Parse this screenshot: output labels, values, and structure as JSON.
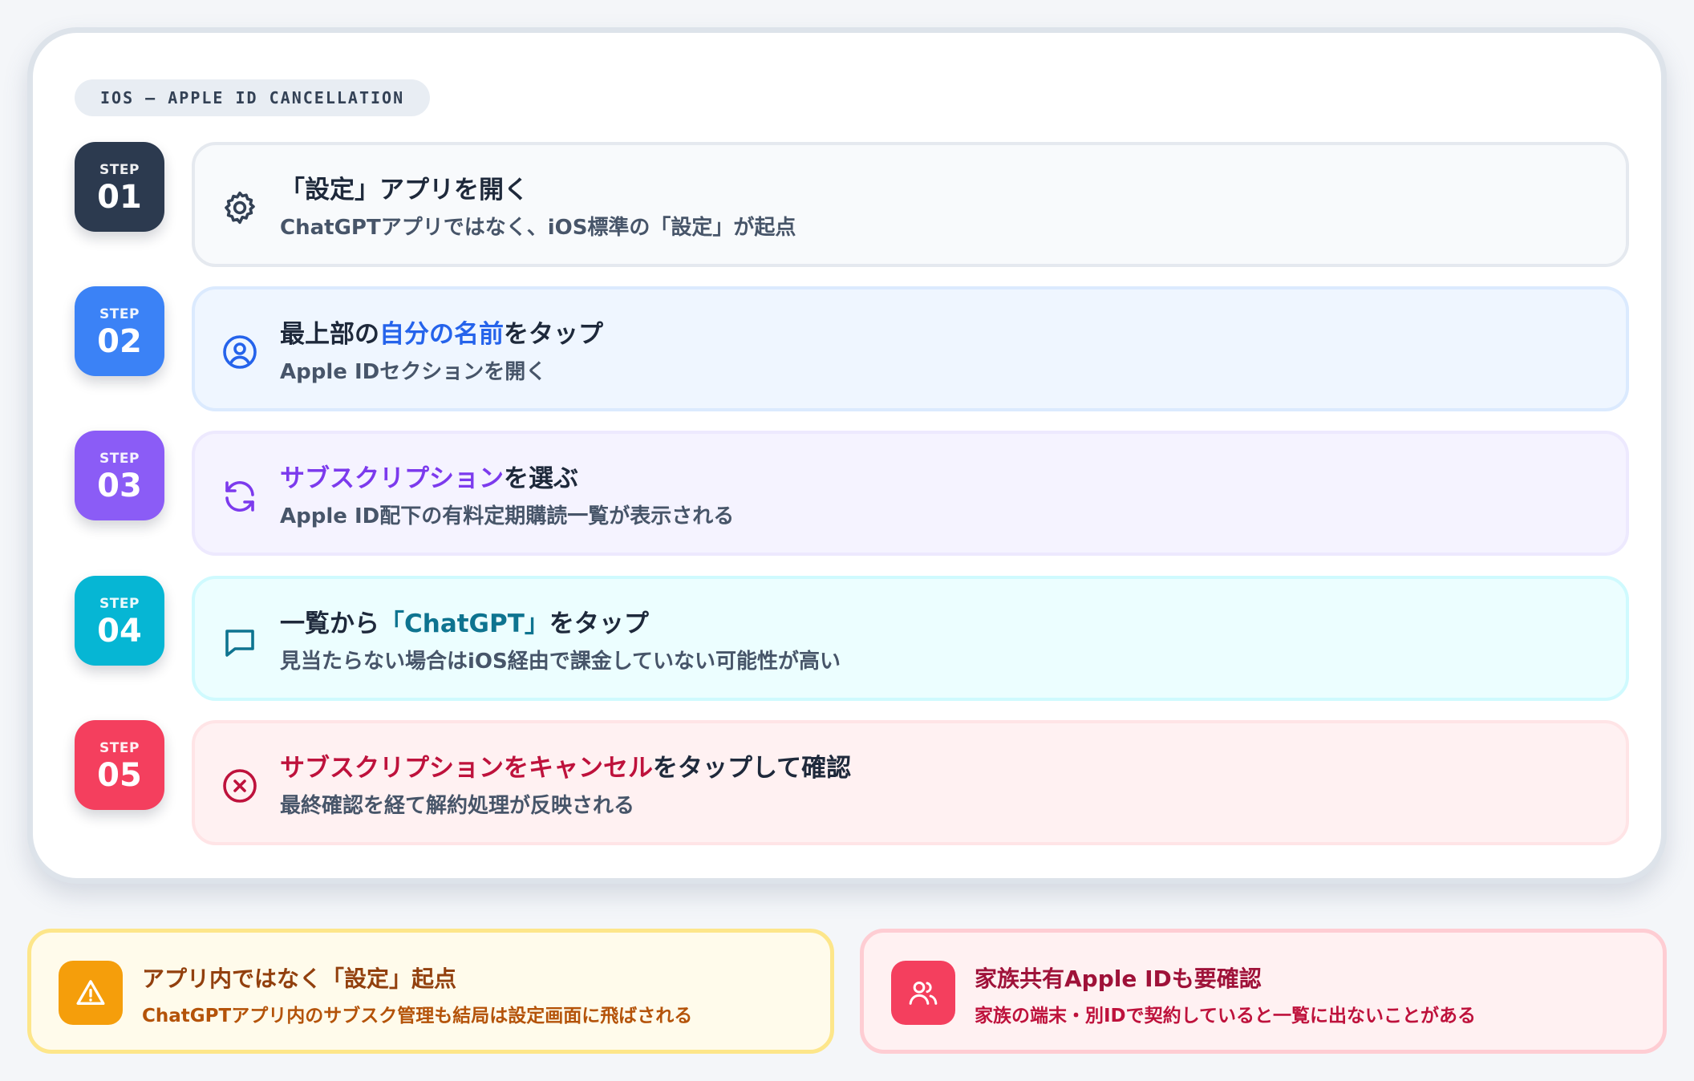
{
  "colors": {
    "step1": "#2c3a4f",
    "step2": "#3b82f6",
    "step3": "#8b5cf6",
    "step4": "#06b6d4",
    "step5": "#f43f5e"
  },
  "header": {
    "label": "IOS – APPLE ID CANCELLATION"
  },
  "steps": [
    {
      "badge_word": "STEP",
      "badge_num": "01",
      "icon": "gear-icon",
      "title_pre": "「設定」アプリを開く",
      "title_hl": "",
      "title_post": "",
      "subtitle": "ChatGPTアプリではなく、iOS標準の「設定」が起点"
    },
    {
      "badge_word": "STEP",
      "badge_num": "02",
      "icon": "user-circle-icon",
      "title_pre": "最上部の",
      "title_hl": "自分の名前",
      "title_post": "をタップ",
      "subtitle": "Apple IDセクションを開く"
    },
    {
      "badge_word": "STEP",
      "badge_num": "03",
      "icon": "refresh-icon",
      "title_pre": "",
      "title_hl": "サブスクリプション",
      "title_post": "を選ぶ",
      "subtitle": "Apple ID配下の有料定期購読一覧が表示される"
    },
    {
      "badge_word": "STEP",
      "badge_num": "04",
      "icon": "message-icon",
      "title_pre": "一覧から",
      "title_hl": "「ChatGPT」",
      "title_post": "をタップ",
      "subtitle": "見当たらない場合はiOS経由で課金していない可能性が高い"
    },
    {
      "badge_word": "STEP",
      "badge_num": "05",
      "icon": "cancel-circle-icon",
      "title_pre": "",
      "title_hl": "サブスクリプションをキャンセル",
      "title_post": "をタップして確認",
      "subtitle": "最終確認を経て解約処理が反映される"
    }
  ],
  "notes": [
    {
      "icon": "warning-icon",
      "title": "アプリ内ではなく「設定」起点",
      "subtitle": "ChatGPTアプリ内のサブスク管理も結局は設定画面に飛ばされる"
    },
    {
      "icon": "users-icon",
      "title": "家族共有Apple IDも要確認",
      "subtitle": "家族の端末・別IDで契約していると一覧に出ないことがある"
    }
  ]
}
